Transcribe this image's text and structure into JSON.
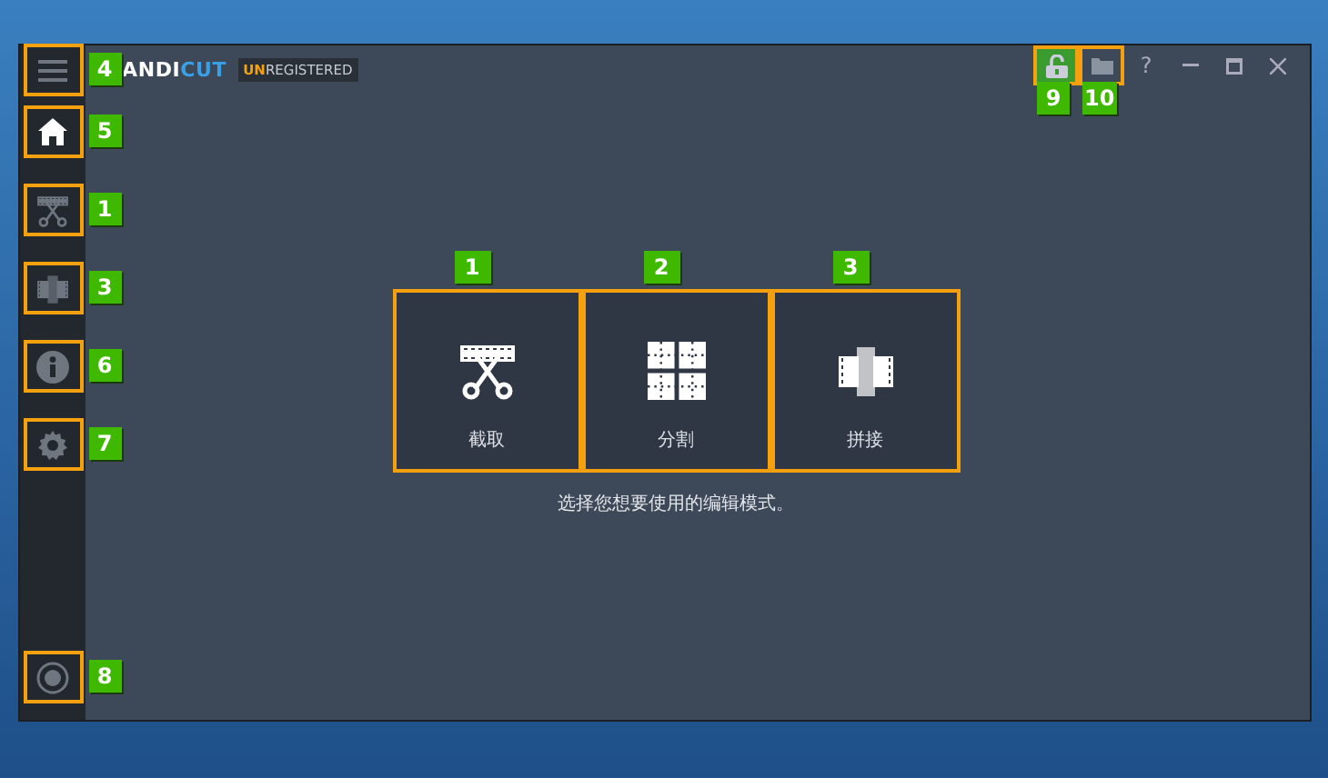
{
  "logo": {
    "main": "ANDI",
    "accent": "CUT"
  },
  "registration": {
    "accent": "UN",
    "rest": "REGISTERED"
  },
  "sidebar": {
    "items": [
      {
        "kind": "menu",
        "badge": "4",
        "selected": false
      },
      {
        "kind": "home",
        "badge": "5",
        "selected": true
      },
      {
        "kind": "trim",
        "badge": "1",
        "selected": false
      },
      {
        "kind": "join",
        "badge": "3",
        "selected": false
      },
      {
        "kind": "info",
        "badge": "6",
        "selected": false
      },
      {
        "kind": "settings",
        "badge": "7",
        "selected": false
      }
    ],
    "bottom": {
      "kind": "record",
      "badge": "8",
      "selected": false
    }
  },
  "title_buttons": [
    {
      "kind": "lock",
      "badge": "9"
    },
    {
      "kind": "folder",
      "badge": "10"
    },
    {
      "kind": "help",
      "label": "?"
    },
    {
      "kind": "minimize"
    },
    {
      "kind": "maximize"
    },
    {
      "kind": "close"
    }
  ],
  "modes": [
    {
      "kind": "trim",
      "label": "截取",
      "badge": "1"
    },
    {
      "kind": "split",
      "label": "分割",
      "badge": "2"
    },
    {
      "kind": "join",
      "label": "拼接",
      "badge": "3"
    }
  ],
  "hint": "选择您想要使用的编辑模式。"
}
